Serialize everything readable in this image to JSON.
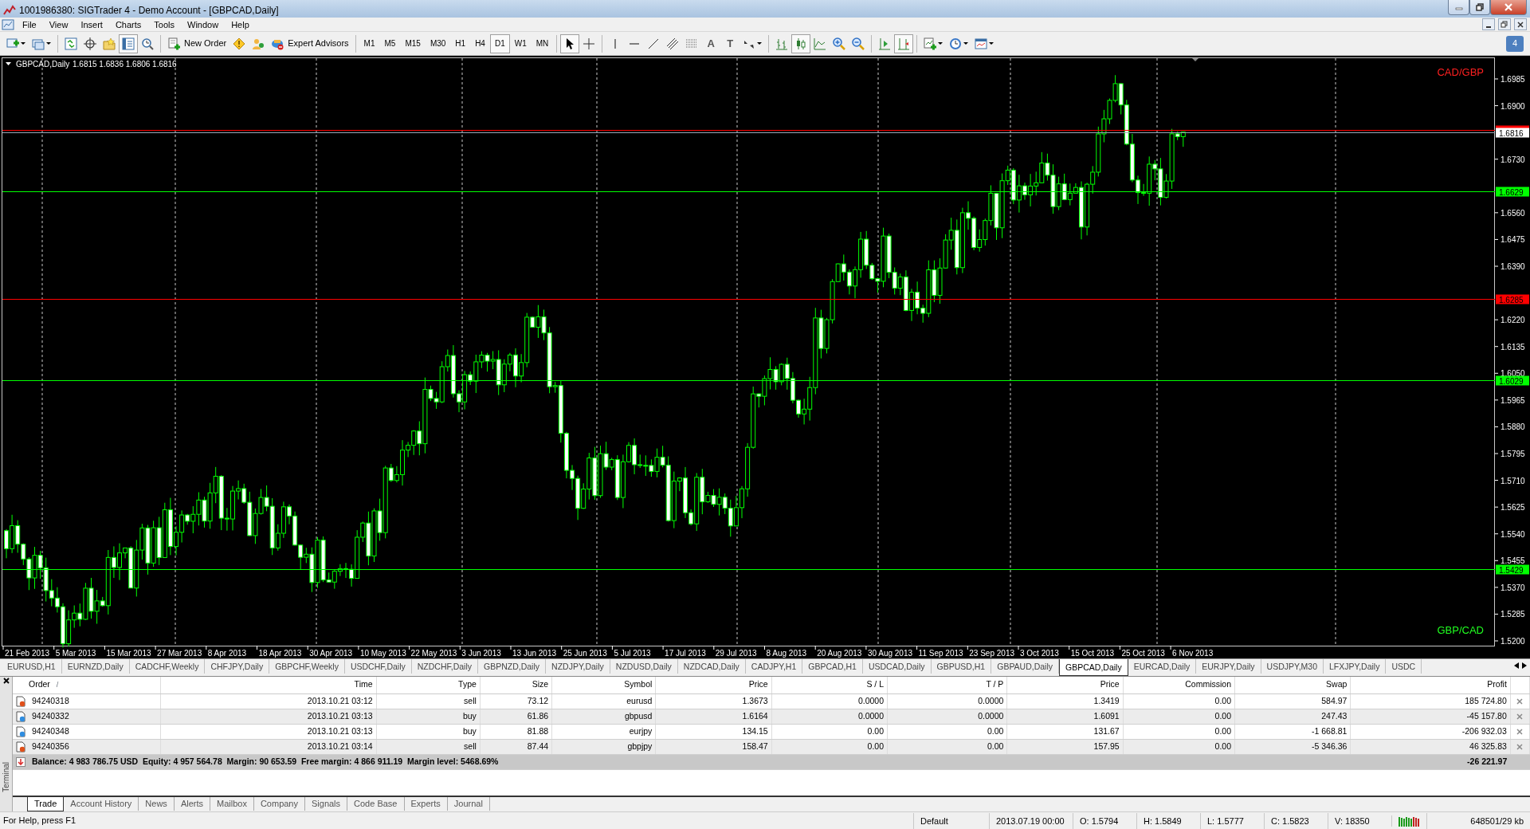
{
  "window": {
    "title": "1001986380: SIGTrader 4 - Demo Account - [GBPCAD,Daily]"
  },
  "menu": [
    "File",
    "View",
    "Insert",
    "Charts",
    "Tools",
    "Window",
    "Help"
  ],
  "toolbar": [
    {
      "kind": "tool",
      "selected": false
    },
    {
      "kind": "tool",
      "selected": false
    },
    {
      "kind": "sep"
    },
    {
      "kind": "tool",
      "selected": false
    },
    {
      "kind": "tool",
      "selected": false
    },
    {
      "kind": "tool",
      "selected": false
    },
    {
      "kind": "tool",
      "selected": true
    },
    {
      "kind": "tool",
      "selected": false
    },
    {
      "kind": "sep"
    },
    {
      "kind": "button",
      "label": "New Order"
    },
    {
      "kind": "tool",
      "selected": false
    },
    {
      "kind": "tool",
      "selected": false
    },
    {
      "kind": "button",
      "label": "Expert Advisors"
    },
    {
      "kind": "sep"
    },
    {
      "kind": "timeframe",
      "label": "M1",
      "selected": false
    },
    {
      "kind": "timeframe",
      "label": "M5",
      "selected": false
    },
    {
      "kind": "timeframe",
      "label": "M15",
      "selected": false
    },
    {
      "kind": "timeframe",
      "label": "M30",
      "selected": false
    },
    {
      "kind": "timeframe",
      "label": "H1",
      "selected": false
    },
    {
      "kind": "timeframe",
      "label": "H4",
      "selected": false
    },
    {
      "kind": "timeframe",
      "label": "D1",
      "selected": true
    },
    {
      "kind": "timeframe",
      "label": "W1",
      "selected": false
    },
    {
      "kind": "timeframe",
      "label": "MN",
      "selected": false
    },
    {
      "kind": "sep"
    },
    {
      "kind": "tool",
      "selected": true
    },
    {
      "kind": "tool",
      "selected": false
    },
    {
      "kind": "sep"
    },
    {
      "kind": "tool",
      "selected": false
    },
    {
      "kind": "tool",
      "selected": false
    },
    {
      "kind": "tool",
      "selected": false
    },
    {
      "kind": "tool",
      "selected": false
    },
    {
      "kind": "tool",
      "selected": false
    },
    {
      "kind": "tool",
      "label": "A",
      "selected": false
    },
    {
      "kind": "tool",
      "label": "T",
      "selected": false
    },
    {
      "kind": "tool",
      "selected": false
    },
    {
      "kind": "sep"
    },
    {
      "kind": "tool",
      "selected": false
    },
    {
      "kind": "tool",
      "selected": true
    },
    {
      "kind": "tool",
      "selected": false
    },
    {
      "kind": "tool",
      "selected": false
    },
    {
      "kind": "tool",
      "selected": false
    },
    {
      "kind": "sep"
    },
    {
      "kind": "tool",
      "selected": false
    },
    {
      "kind": "tool",
      "selected": true
    },
    {
      "kind": "sep"
    },
    {
      "kind": "tool",
      "selected": false
    },
    {
      "kind": "tool",
      "selected": false
    },
    {
      "kind": "tool",
      "selected": false
    }
  ],
  "notifications": "4",
  "chart": {
    "symbol": "GBPCAD,Daily",
    "ohlc": "1.6815 1.6836 1.6806 1.6816",
    "label_top": "CAD/GBP",
    "label_bottom": "GBP/CAD",
    "price_ticks": [
      "1.6985",
      "1.6900",
      "1.6730",
      "1.6560",
      "1.6475",
      "1.6390",
      "1.6220",
      "1.6135",
      "1.6050",
      "1.5965",
      "1.5880",
      "1.5795",
      "1.5710",
      "1.5625",
      "1.5540",
      "1.5455",
      "1.5370",
      "1.5285",
      "1.5200"
    ],
    "levels": [
      {
        "color": "#ff0000"
      },
      {
        "label": "1.6629",
        "color": "#00ff00"
      },
      {
        "label": "1.6285",
        "color": "#ff0000"
      },
      {
        "label": "1.6029",
        "color": "#00ff00"
      },
      {
        "label": "1.5429",
        "color": "#00ff00"
      }
    ],
    "current_price": "1.6816",
    "dates": [
      "21 Feb 2013",
      "5 Mar 2013",
      "15 Mar 2013",
      "27 Mar 2013",
      "8 Apr 2013",
      "18 Apr 2013",
      "30 Apr 2013",
      "10 May 2013",
      "22 May 2013",
      "3 Jun 2013",
      "13 Jun 2013",
      "25 Jun 2013",
      "5 Jul 2013",
      "17 Jul 2013",
      "29 Jul 2013",
      "8 Aug 2013",
      "20 Aug 2013",
      "30 Aug 2013",
      "11 Sep 2013",
      "23 Sep 2013",
      "3 Oct 2013",
      "15 Oct 2013",
      "25 Oct 2013",
      "6 Nov 2013"
    ]
  },
  "chart_tabs": [
    {
      "label": "EURUSD,H1",
      "selected": false
    },
    {
      "label": "EURNZD,Daily",
      "selected": false
    },
    {
      "label": "CADCHF,Weekly",
      "selected": false
    },
    {
      "label": "CHFJPY,Daily",
      "selected": false
    },
    {
      "label": "GBPCHF,Weekly",
      "selected": false
    },
    {
      "label": "USDCHF,Daily",
      "selected": false
    },
    {
      "label": "NZDCHF,Daily",
      "selected": false
    },
    {
      "label": "GBPNZD,Daily",
      "selected": false
    },
    {
      "label": "NZDJPY,Daily",
      "selected": false
    },
    {
      "label": "NZDUSD,Daily",
      "selected": false
    },
    {
      "label": "NZDCAD,Daily",
      "selected": false
    },
    {
      "label": "CADJPY,H1",
      "selected": false
    },
    {
      "label": "GBPCAD,H1",
      "selected": false
    },
    {
      "label": "USDCAD,Daily",
      "selected": false
    },
    {
      "label": "GBPUSD,H1",
      "selected": false
    },
    {
      "label": "GBPAUD,Daily",
      "selected": false
    },
    {
      "label": "GBPCAD,Daily",
      "selected": true
    },
    {
      "label": "EURCAD,Daily",
      "selected": false
    },
    {
      "label": "EURJPY,Daily",
      "selected": false
    },
    {
      "label": "USDJPY,M30",
      "selected": false
    },
    {
      "label": "LFXJPY,Daily",
      "selected": false
    },
    {
      "label": "USDC",
      "selected": false
    }
  ],
  "terminal": {
    "title": "Terminal",
    "columns": [
      {
        "label": "Order",
        "sort_mark": "/"
      },
      {
        "label": "Time"
      },
      {
        "label": "Type"
      },
      {
        "label": "Size"
      },
      {
        "label": "Symbol"
      },
      {
        "label": "Price"
      },
      {
        "label": "S / L"
      },
      {
        "label": "T / P"
      },
      {
        "label": "Price"
      },
      {
        "label": "Commission"
      },
      {
        "label": "Swap"
      },
      {
        "label": "Profit"
      }
    ],
    "rows": [
      {
        "kind": "sell",
        "cells": [
          "94240318",
          "2013.10.21 03:12",
          "sell",
          "73.12",
          "eurusd",
          "1.3673",
          "0.0000",
          "0.0000",
          "1.3419",
          "0.00",
          "584.97",
          "185 724.80"
        ]
      },
      {
        "kind": "buy",
        "cells": [
          "94240332",
          "2013.10.21 03:13",
          "buy",
          "61.86",
          "gbpusd",
          "1.6164",
          "0.0000",
          "0.0000",
          "1.6091",
          "0.00",
          "247.43",
          "-45 157.80"
        ]
      },
      {
        "kind": "buy",
        "cells": [
          "94240348",
          "2013.10.21 03:13",
          "buy",
          "81.88",
          "eurjpy",
          "134.15",
          "0.00",
          "0.00",
          "131.67",
          "0.00",
          "-1 668.81",
          "-206 932.03"
        ]
      },
      {
        "kind": "sell",
        "cells": [
          "94240356",
          "2013.10.21 03:14",
          "sell",
          "87.44",
          "gbpjpy",
          "158.47",
          "0.00",
          "0.00",
          "157.95",
          "0.00",
          "-5 346.36",
          "46 325.83"
        ]
      }
    ],
    "summary": "Balance: 4 983 786.75 USD  Equity: 4 957 564.78  Margin: 90 653.59  Free margin: 4 866 911.19  Margin level: 5468.69%",
    "total": "-26 221.97",
    "tabs": [
      {
        "label": "Trade",
        "selected": true
      },
      {
        "label": "Account History",
        "selected": false
      },
      {
        "label": "News",
        "selected": false
      },
      {
        "label": "Alerts",
        "selected": false
      },
      {
        "label": "Mailbox",
        "selected": false
      },
      {
        "label": "Company",
        "selected": false
      },
      {
        "label": "Signals",
        "selected": false
      },
      {
        "label": "Code Base",
        "selected": false
      },
      {
        "label": "Experts",
        "selected": false
      },
      {
        "label": "Journal",
        "selected": false
      }
    ]
  },
  "status_bar": {
    "help": "For Help, press F1",
    "profile": "Default",
    "time": "2013.07.19 00:00",
    "open": "O: 1.5794",
    "high": "H: 1.5849",
    "low": "L: 1.5777",
    "close": "C: 1.5823",
    "volume": "V: 18350",
    "traffic": "648501/29 kb"
  }
}
